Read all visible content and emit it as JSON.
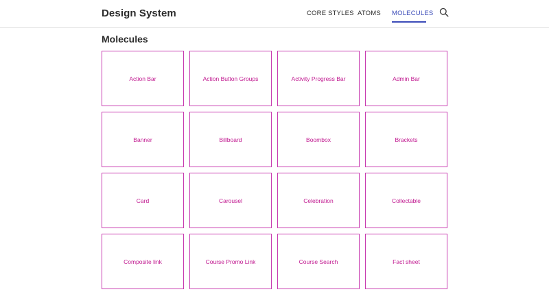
{
  "header": {
    "brand": "Design System",
    "nav": [
      {
        "label": "CORE STYLES",
        "active": false
      },
      {
        "label": "ATOMS",
        "active": false
      },
      {
        "label": "MOLECULES",
        "active": true
      }
    ],
    "search_icon": "search-icon"
  },
  "main": {
    "title": "Molecules",
    "tiles": [
      "Action Bar",
      "Action Button Groups",
      "Activity Progress Bar",
      "Admin Bar",
      "Banner",
      "Billboard",
      "Boombox",
      "Brackets",
      "Card",
      "Carousel",
      "Celebration",
      "Collectable",
      "Composite link",
      "Course Promo Link",
      "Course Search",
      "Fact sheet"
    ]
  },
  "colors": {
    "accent": "#c83bb0",
    "tile_text": "#c0178f",
    "nav_active": "#3b4bb8"
  }
}
